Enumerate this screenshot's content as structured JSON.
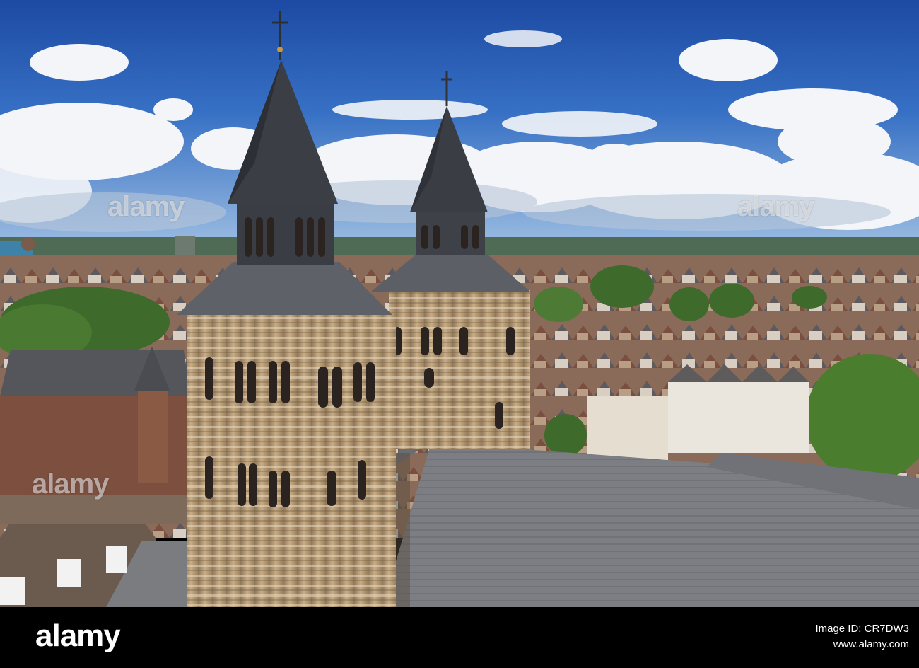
{
  "photo": {
    "subject": "Basilica of Saint Servatius towers over Maastricht rooftops",
    "palette": {
      "sky_top": "#1f4fa8",
      "sky_mid": "#3b72c6",
      "sky_low": "#8ab0de",
      "cloud": "#f4f6f9",
      "stone": "#b59a76",
      "roof_slate": "#6e7075",
      "spire": "#3c3f45",
      "trees": "#3d6b2a",
      "brick": "#8a5a48"
    }
  },
  "watermarks": [
    "alamy",
    "alamy",
    "alamy"
  ],
  "footer": {
    "logo": "alamy",
    "image_id": "Image ID: CR7DW3",
    "site": "www.alamy.com"
  }
}
